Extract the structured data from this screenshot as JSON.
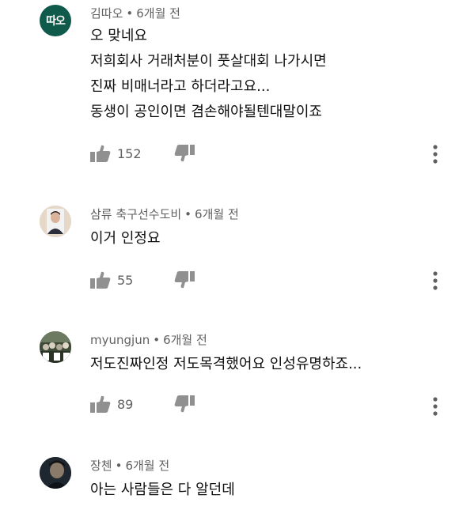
{
  "comments": [
    {
      "avatar_label": "따오",
      "avatar_bg": "#0f5a4a",
      "author": "김따오",
      "time": "6개월 전",
      "lines": [
        "오 맞네요",
        "저희회사 거래처분이 풋살대회 나가시면",
        "진짜 비매너라고 하더라고요...",
        "동생이 공인이면 겸손해야될텐대말이죠"
      ],
      "likes": "152"
    },
    {
      "avatar_label": "",
      "avatar_bg": "#d8c4b2",
      "author": "삼류 축구선수도비",
      "time": "6개월 전",
      "lines": [
        "이거 인정요"
      ],
      "likes": "55"
    },
    {
      "avatar_label": "",
      "avatar_bg": "#4a5a44",
      "author": "myungjun",
      "time": "6개월 전",
      "lines": [
        "저도진짜인정 저도목격했어요 인성유명하죠..."
      ],
      "likes": "89"
    },
    {
      "avatar_label": "",
      "avatar_bg": "#1e2630",
      "author": "장첸",
      "time": "6개월 전",
      "lines": [
        "아는 사람들은 다 알던데"
      ],
      "likes": ""
    }
  ],
  "icons": {
    "like": "thumbs-up-icon",
    "dislike": "thumbs-down-icon",
    "more": "more-vertical-icon"
  }
}
